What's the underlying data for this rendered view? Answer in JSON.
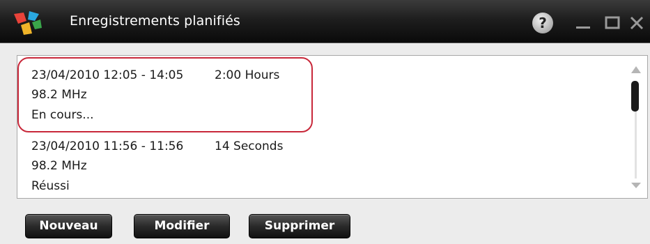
{
  "window": {
    "title": "Enregistrements planifiés",
    "help_label": "?",
    "colors": {
      "titlebar": "#111111",
      "highlight_border": "#c8283a"
    }
  },
  "recordings": [
    {
      "time_range": "23/04/2010 12:05 - 14:05",
      "duration": "2:00 Hours",
      "frequency": "98.2 MHz",
      "status": "En cours..."
    },
    {
      "time_range": "23/04/2010 11:56 - 11:56",
      "duration": "14 Seconds",
      "frequency": "98.2 MHz",
      "status": "Réussi"
    }
  ],
  "buttons": {
    "new": "Nouveau",
    "edit": "Modifier",
    "delete": "Supprimer"
  }
}
